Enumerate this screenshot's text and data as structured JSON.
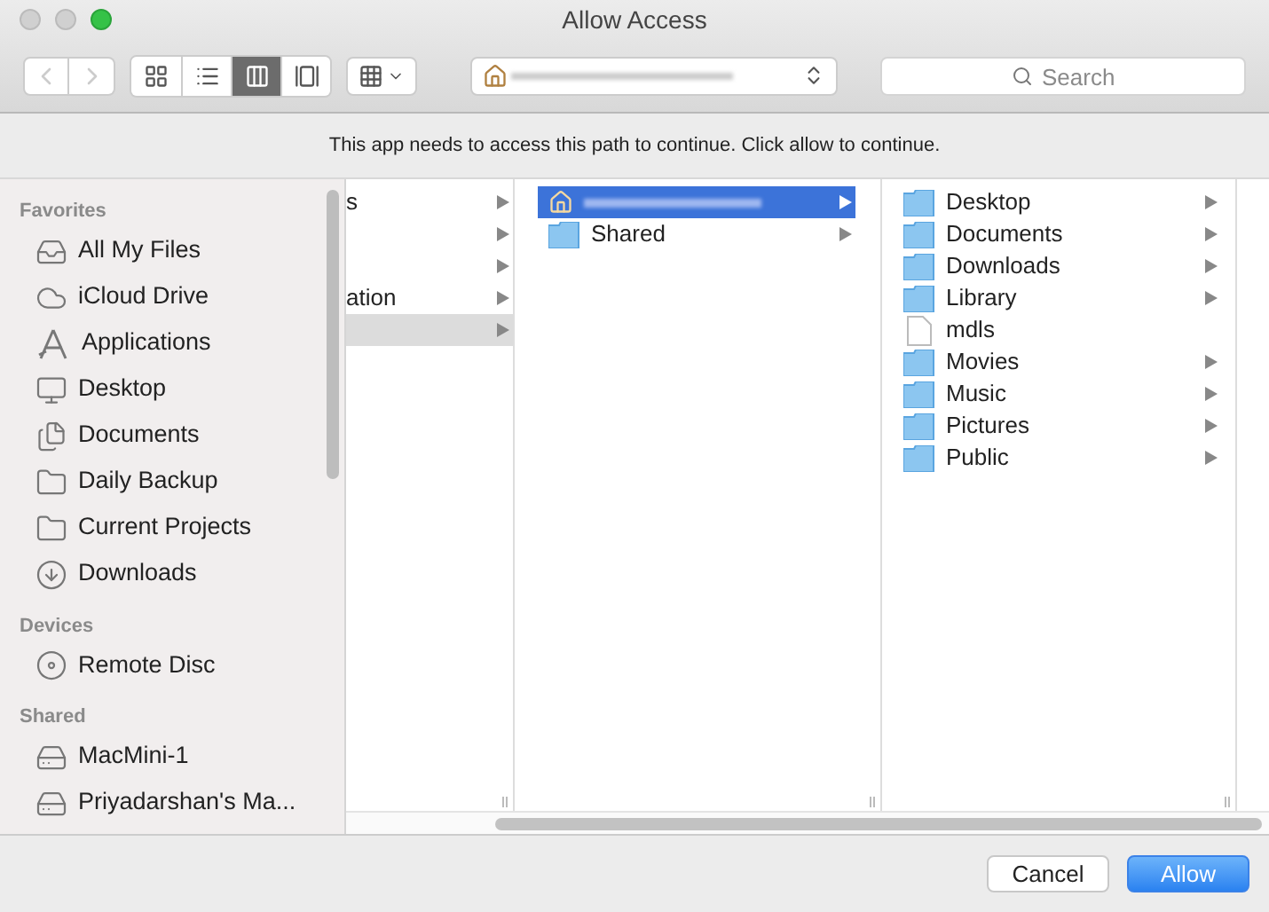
{
  "window": {
    "title": "Allow Access"
  },
  "toolbar": {
    "view_modes": [
      {
        "kind": "icons",
        "selected": false
      },
      {
        "kind": "list",
        "selected": false
      },
      {
        "kind": "columns",
        "selected": true
      },
      {
        "kind": "coverflow",
        "selected": false
      }
    ],
    "search": {
      "placeholder": "Search"
    }
  },
  "message": "This app needs to access this path to continue. Click allow to continue.",
  "sidebar": {
    "sections": [
      {
        "title": "Favorites",
        "items": [
          {
            "label": "All My Files",
            "kind": "stack"
          },
          {
            "label": "iCloud Drive",
            "kind": "cloud"
          },
          {
            "label": "Applications",
            "kind": "apps"
          },
          {
            "label": "Desktop",
            "kind": "desktop"
          },
          {
            "label": "Documents",
            "kind": "documents"
          },
          {
            "label": "Daily Backup",
            "kind": "folder"
          },
          {
            "label": "Current Projects",
            "kind": "folder"
          },
          {
            "label": "Downloads",
            "kind": "download"
          }
        ]
      },
      {
        "title": "Devices",
        "items": [
          {
            "label": "Remote Disc",
            "kind": "disc"
          }
        ]
      },
      {
        "title": "Shared",
        "items": [
          {
            "label": "MacMini-1",
            "kind": "server"
          },
          {
            "label": "Priyadarshan's Ma...",
            "kind": "server"
          }
        ]
      }
    ]
  },
  "columns": [
    {
      "items": [
        {
          "label": "s",
          "selected": false
        },
        {
          "selected": false
        },
        {
          "selected": false
        },
        {
          "label": "ation",
          "selected": false
        },
        {
          "selected": true
        }
      ]
    },
    {
      "items": [
        {
          "kind": "home",
          "selected": true,
          "has_children": true
        },
        {
          "kind": "folder",
          "label": "Shared",
          "selected": false,
          "has_children": true
        }
      ]
    },
    {
      "items": [
        {
          "kind": "folder",
          "label": "Desktop",
          "selected": false,
          "has_children": true
        },
        {
          "kind": "folder",
          "label": "Documents",
          "selected": false,
          "has_children": true
        },
        {
          "kind": "folder",
          "label": "Downloads",
          "selected": false,
          "has_children": true
        },
        {
          "kind": "folder",
          "label": "Library",
          "selected": false,
          "has_children": true
        },
        {
          "kind": "file",
          "label": "mdls",
          "selected": false,
          "has_children": false
        },
        {
          "kind": "folder",
          "label": "Movies",
          "selected": false,
          "has_children": true
        },
        {
          "kind": "folder",
          "label": "Music",
          "selected": false,
          "has_children": true
        },
        {
          "kind": "folder",
          "label": "Pictures",
          "selected": false,
          "has_children": true
        },
        {
          "kind": "folder",
          "label": "Public",
          "selected": false,
          "has_children": true
        }
      ]
    }
  ],
  "buttons": [
    {
      "label": "Cancel",
      "kind": "default"
    },
    {
      "label": "Allow",
      "kind": "primary"
    }
  ]
}
